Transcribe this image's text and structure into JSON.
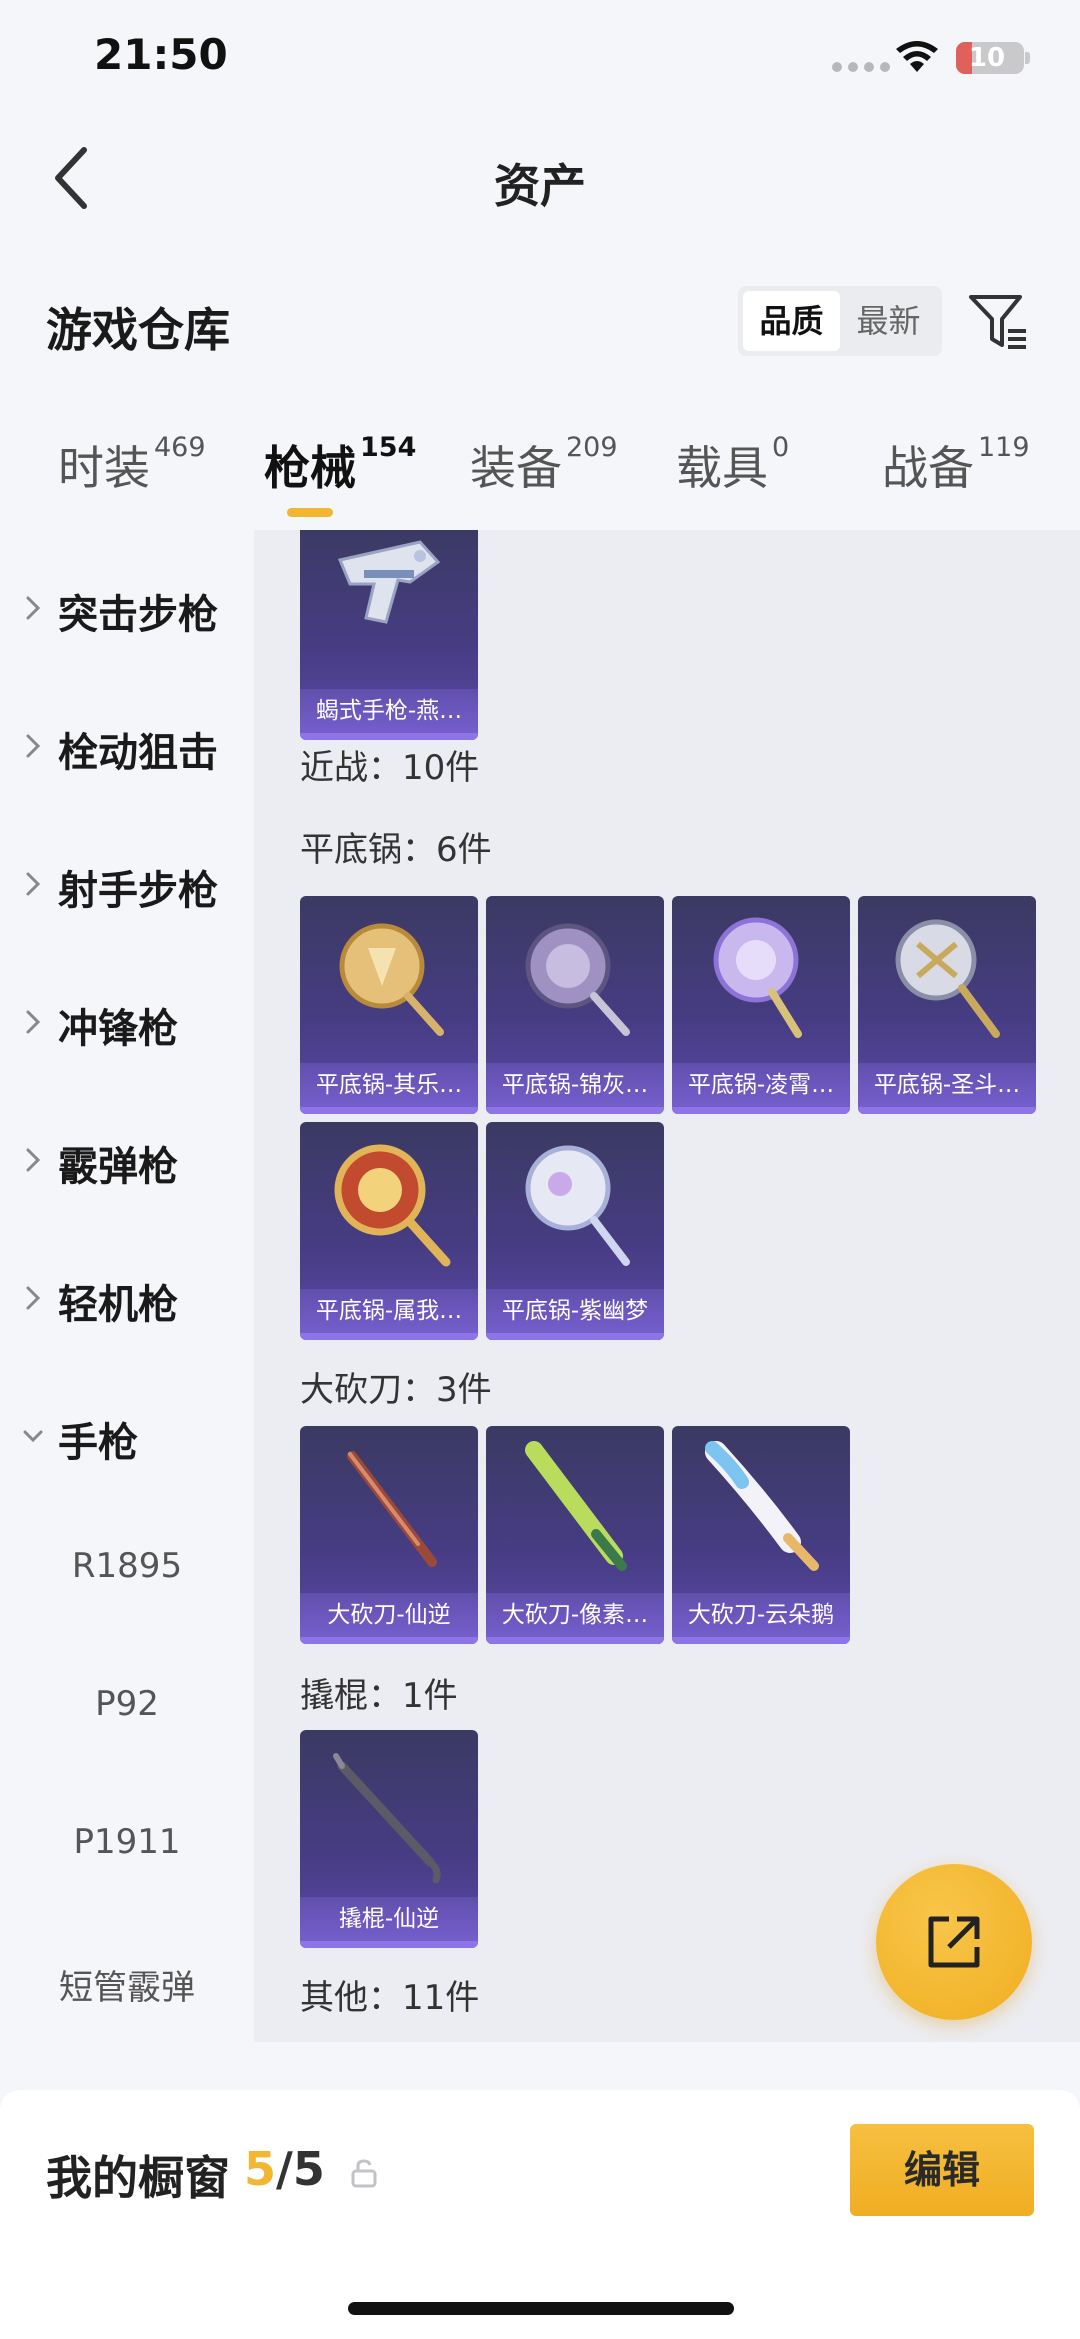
{
  "status_bar": {
    "time": "21:50",
    "battery": "10"
  },
  "nav": {
    "title": "资产"
  },
  "warehouse": {
    "title": "游戏仓库",
    "sort_options": [
      "品质",
      "最新"
    ],
    "active_sort": "品质"
  },
  "tabs": [
    {
      "label": "时装",
      "count": "469",
      "active": false
    },
    {
      "label": "枪械",
      "count": "154",
      "active": true
    },
    {
      "label": "装备",
      "count": "209",
      "active": false
    },
    {
      "label": "载具",
      "count": "0",
      "active": false
    },
    {
      "label": "战备",
      "count": "119",
      "active": false
    }
  ],
  "sidebar": {
    "categories": [
      "突击步枪",
      "栓动狙击",
      "射手步枪",
      "冲锋枪",
      "霰弹枪",
      "轻机枪",
      "手枪"
    ],
    "expanded": "手枪",
    "sub_items": [
      "R1895",
      "P92",
      "P1911",
      "短管霰弹"
    ]
  },
  "content": {
    "top_card": {
      "label": "蝎式手枪-燕…"
    },
    "groups": [
      {
        "heading": "近战：10件"
      },
      {
        "heading": "平底锅：6件",
        "items": [
          "平底锅-其乐…",
          "平底锅-锦灰…",
          "平底锅-凌霄…",
          "平底锅-圣斗…",
          "平底锅-属我…",
          "平底锅-紫幽梦"
        ]
      },
      {
        "heading": "大砍刀：3件",
        "items": [
          "大砍刀-仙逆",
          "大砍刀-像素…",
          "大砍刀-云朵鹅"
        ]
      },
      {
        "heading": "撬棍：1件",
        "items": [
          "撬棍-仙逆"
        ]
      },
      {
        "heading": "其他：11件"
      }
    ]
  },
  "showcase": {
    "title": "我的橱窗",
    "current": "5",
    "total": "/5",
    "edit_label": "编辑"
  },
  "colors": {
    "accent": "#f2b632",
    "card_purple": "#463c82",
    "background": "#f5f6fa"
  }
}
